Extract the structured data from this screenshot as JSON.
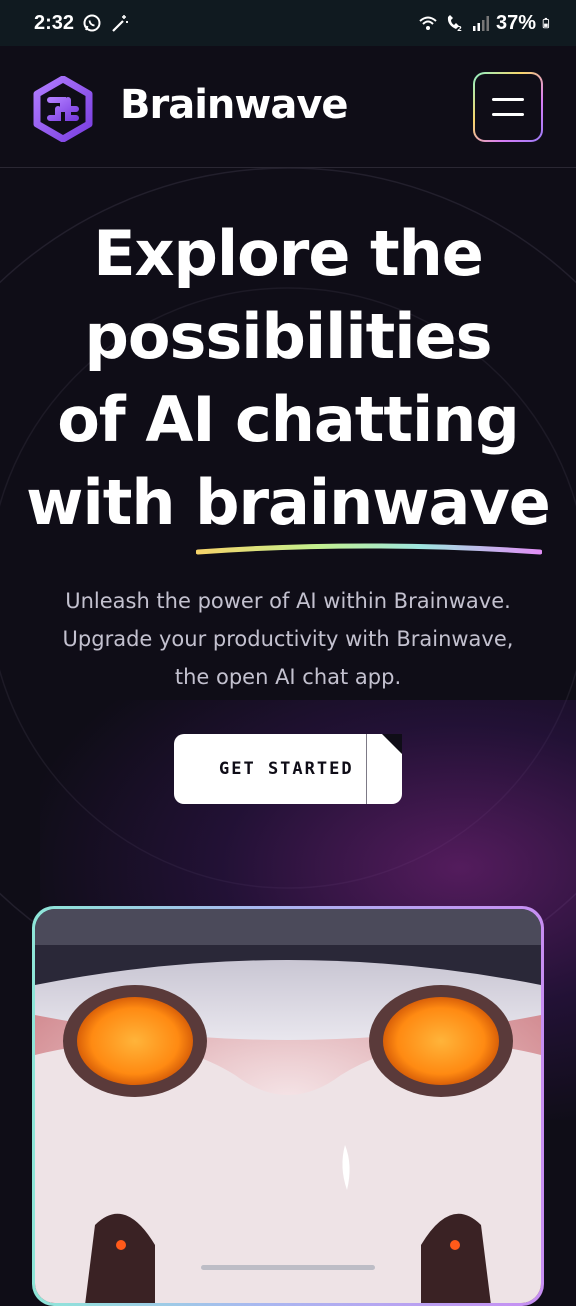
{
  "status_bar": {
    "time": "2:32",
    "battery": "37%",
    "icons_left": [
      "whatsapp-icon",
      "magic-wand-icon"
    ],
    "icons_right": [
      "wifi-icon",
      "wifi-call-icon",
      "signal-icon",
      "battery-icon"
    ]
  },
  "header": {
    "brand": "Brainwave",
    "logo_icon": "brain-logo-icon",
    "menu_icon": "hamburger-menu-icon"
  },
  "hero": {
    "title_lines": [
      "Explore the",
      "possibilities",
      "of AI chatting",
      "with brainwave"
    ],
    "subtitle_lines": [
      "Unleash the power of AI within Brainwave.",
      "Upgrade your productivity with Brainwave,",
      "the open AI chat app."
    ],
    "cta_label": "GET STARTED"
  },
  "colors": {
    "background": "#0f0d17",
    "status_bar": "#101a20",
    "accent_purple": "#9a5cf0",
    "button_bg": "#ffffff",
    "eye_orange": "#ff9a1f"
  }
}
